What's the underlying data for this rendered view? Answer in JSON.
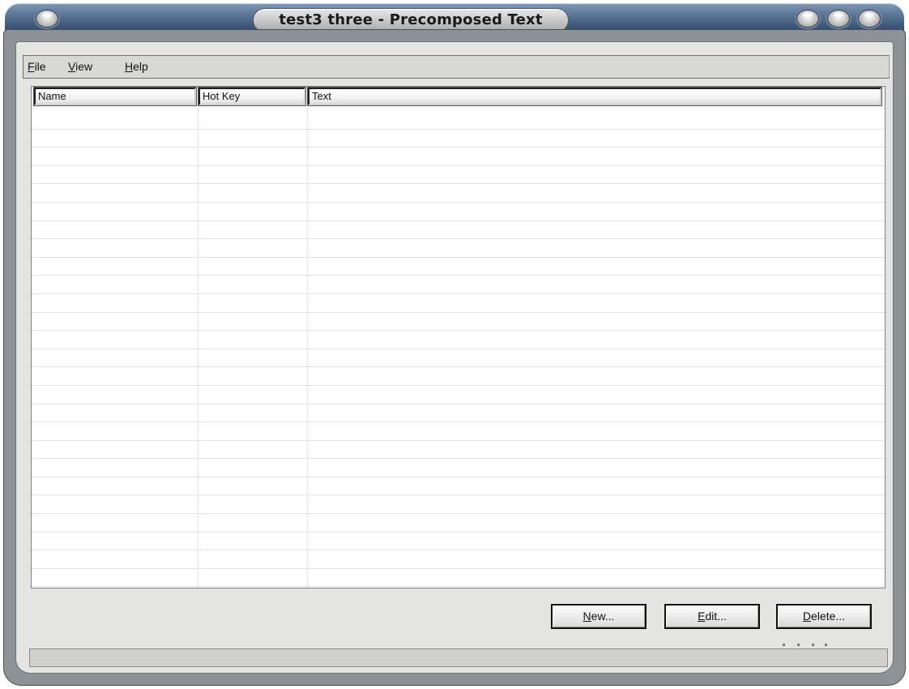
{
  "window": {
    "title": "test3 three - Precomposed Text"
  },
  "menu": {
    "items": [
      {
        "label": "File",
        "accel": "F",
        "rest": "ile"
      },
      {
        "label": "View",
        "accel": "V",
        "rest": "iew"
      },
      {
        "label": "Help",
        "accel": "H",
        "rest": "elp"
      }
    ]
  },
  "table": {
    "columns": [
      "Name",
      "Hot Key",
      "Text"
    ],
    "rows": []
  },
  "buttons": {
    "new": {
      "accel": "N",
      "rest": "ew..."
    },
    "edit": {
      "accel": "E",
      "rest": "dit..."
    },
    "delete": {
      "accel": "D",
      "rest": "elete..."
    }
  },
  "status": {
    "text": ""
  }
}
